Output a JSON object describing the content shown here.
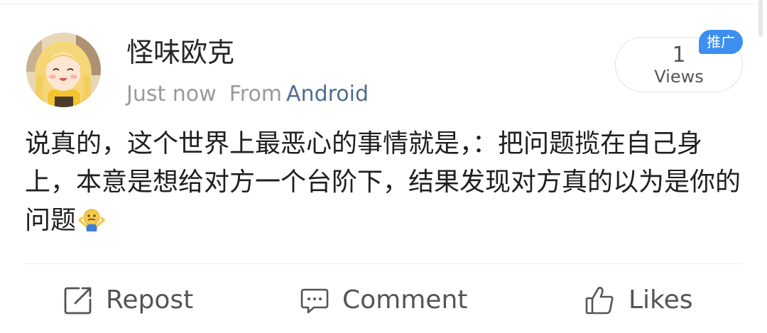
{
  "post": {
    "author": "怪味欧克",
    "time": "Just now",
    "from_label": "From",
    "source": "Android",
    "views": {
      "count": "1",
      "label": "Views"
    },
    "promo_badge": "推广",
    "content": "说真的，这个世界上最恶心的事情就是，：把问题揽在自己身上，本意是想给对方一个台阶下，结果发现对方真的以为是你的问题",
    "emoji_icon": "shrug-emoji-icon"
  },
  "actions": {
    "repost": "Repost",
    "comment": "Comment",
    "likes": "Likes"
  },
  "colors": {
    "source_link": "#4f6d91",
    "promo_badge": "#3c8ff0",
    "secondary_text": "#9a9a9a"
  }
}
